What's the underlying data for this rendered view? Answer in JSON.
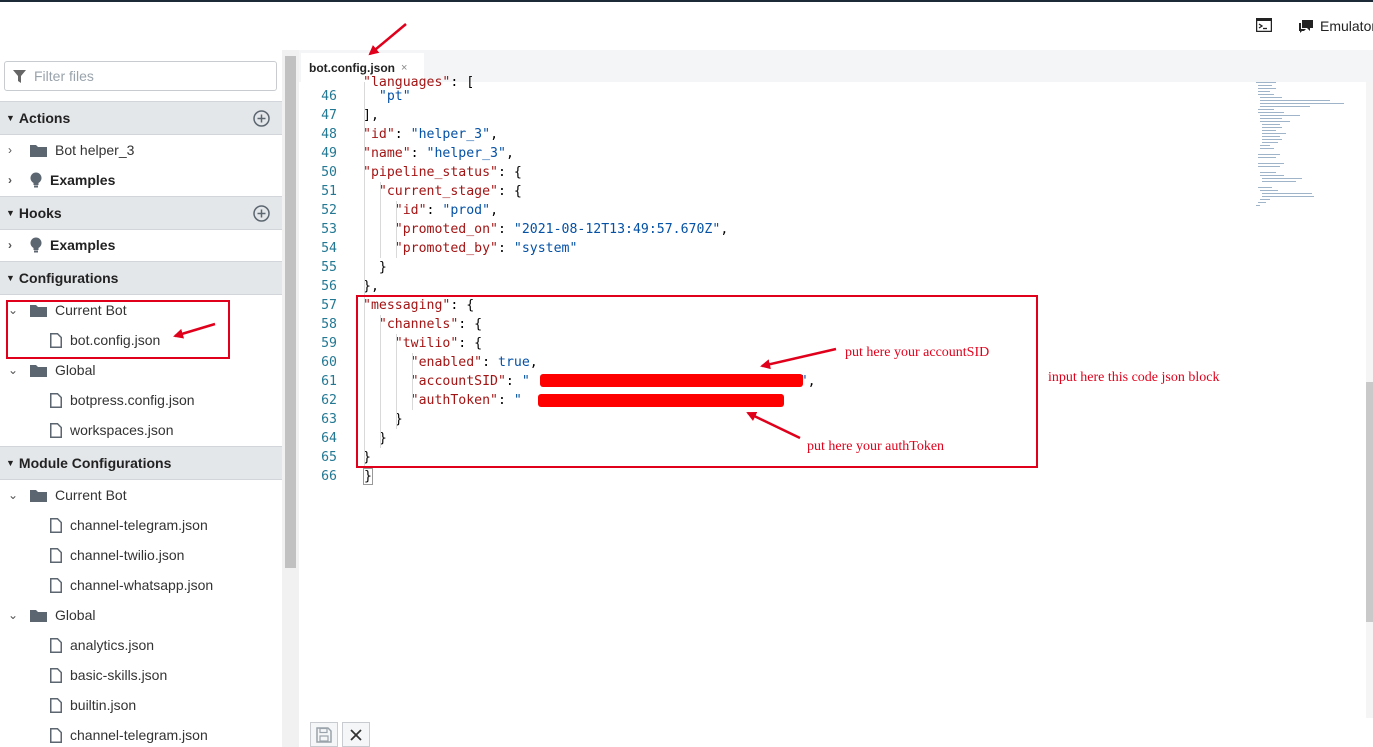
{
  "topbar": {
    "terminal_icon": "terminal-icon",
    "emulator_label": "Emulator",
    "emulator_icon": "chat-icon"
  },
  "sidebar": {
    "filter_placeholder": "Filter files",
    "sections": {
      "actions": "Actions",
      "hooks": "Hooks",
      "configurations": "Configurations",
      "module_configurations": "Module Configurations"
    },
    "actions_items": [
      "Bot helper_3",
      "Examples"
    ],
    "hooks_items": [
      "Examples"
    ],
    "config_current_bot": "Current Bot",
    "config_current_bot_files": [
      "bot.config.json"
    ],
    "config_global": "Global",
    "config_global_files": [
      "botpress.config.json",
      "workspaces.json"
    ],
    "module_current_bot": "Current Bot",
    "module_current_bot_files": [
      "channel-telegram.json",
      "channel-twilio.json",
      "channel-whatsapp.json"
    ],
    "module_global": "Global",
    "module_global_files": [
      "analytics.json",
      "basic-skills.json",
      "builtin.json",
      "channel-telegram.json"
    ]
  },
  "editor": {
    "tab_label": "bot.config.json",
    "tab_close": "×",
    "line_numbers": [
      "46",
      "47",
      "48",
      "49",
      "50",
      "51",
      "52",
      "53",
      "54",
      "55",
      "56",
      "57",
      "58",
      "59",
      "60",
      "61",
      "62",
      "63",
      "64",
      "65",
      "66"
    ]
  },
  "annotations": {
    "account_sid_note": "put here your accountSID",
    "auth_token_note": "put here your authToken",
    "block_note": "input here this code json block"
  },
  "colors": {
    "annotation_red": "#e0001b",
    "line_number": "#237893",
    "json_key": "#a31515",
    "json_string": "#0451a5"
  }
}
